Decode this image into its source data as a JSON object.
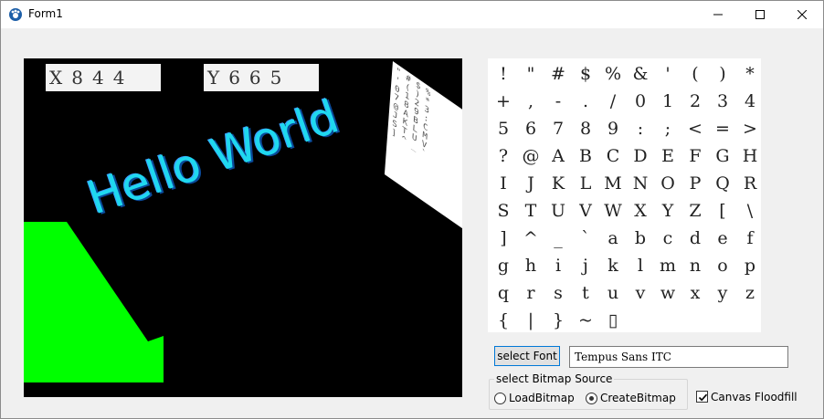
{
  "window": {
    "title": "Form1"
  },
  "canvas": {
    "coord_x": "X844",
    "coord_y": "Y665",
    "text": "Hello World",
    "minimap_rows": [
      "\" # $ %",
      "' ( ) *",
      "0 1 2 3",
      "7 8 9 :",
      "@ A B C",
      "J K L M",
      "S T U V",
      "] ^ _ `"
    ]
  },
  "charmap": {
    "rows": [
      [
        "!",
        "\"",
        "#",
        "$",
        "%",
        "&",
        "'",
        "(",
        ")",
        "*"
      ],
      [
        "+",
        ",",
        "-",
        ".",
        "/",
        "0",
        "1",
        "2",
        "3",
        "4"
      ],
      [
        "5",
        "6",
        "7",
        "8",
        "9",
        ":",
        ";",
        "<",
        "=",
        ">"
      ],
      [
        "?",
        "@",
        "A",
        "B",
        "C",
        "D",
        "E",
        "F",
        "G",
        "H"
      ],
      [
        "I",
        "J",
        "K",
        "L",
        "M",
        "N",
        "O",
        "P",
        "Q",
        "R"
      ],
      [
        "S",
        "T",
        "U",
        "V",
        "W",
        "X",
        "Y",
        "Z",
        "[",
        "\\"
      ],
      [
        "]",
        "^",
        "_",
        "`",
        "a",
        "b",
        "c",
        "d",
        "e",
        "f"
      ],
      [
        "g",
        "h",
        "i",
        "j",
        "k",
        "l",
        "m",
        "n",
        "o",
        "p"
      ],
      [
        "q",
        "r",
        "s",
        "t",
        "u",
        "v",
        "w",
        "x",
        "y",
        "z"
      ],
      [
        "{",
        "|",
        "}",
        "~",
        "▯"
      ]
    ]
  },
  "controls": {
    "select_font_label": "select Font",
    "font_name": "Tempus Sans ITC",
    "group_label": "select Bitmap Source",
    "radio_load": "LoadBitmap",
    "radio_create": "CreateBitmap",
    "radio_selected": "CreateBitmap",
    "floodfill_label": "Canvas Floodfill",
    "floodfill_checked": true
  },
  "colors": {
    "hello": "#1fd8ef",
    "green_shape": "#00ff00",
    "canvas_bg": "#000000"
  }
}
